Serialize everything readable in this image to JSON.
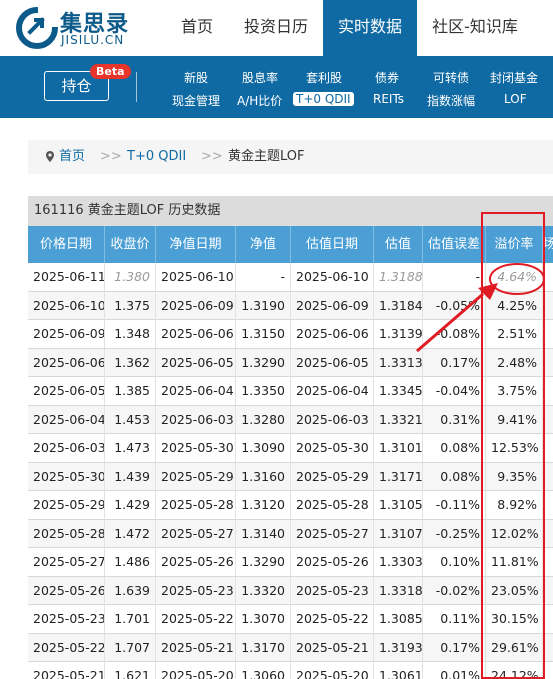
{
  "header": {
    "logo_cn": "集思录",
    "logo_en": "JISILU.CN",
    "nav": [
      {
        "label": "首页"
      },
      {
        "label": "投资日历"
      },
      {
        "label": "实时数据"
      },
      {
        "label": "社区-知识库"
      }
    ],
    "active_nav": "实时数据"
  },
  "subnav": {
    "hold_label": "持仓",
    "beta_label": "Beta",
    "row1": [
      "新股",
      "股息率",
      "套利股",
      "债券",
      "可转债",
      "封闭基金"
    ],
    "row2": [
      "现金管理",
      "A/H比价",
      "T+0 QDII",
      "REITs",
      "指数涨幅",
      "LOF"
    ],
    "active": "T+0 QDII"
  },
  "breadcrumb": {
    "home": "首页",
    "sep": ">>",
    "section": "T+0 QDII",
    "current": "黄金主题LOF"
  },
  "table": {
    "title": "161116 黄金主题LOF 历史数据",
    "columns": [
      "价格日期",
      "收盘价",
      "净值日期",
      "净值",
      "估值日期",
      "估值",
      "估值误差",
      "溢价率",
      "场"
    ],
    "rows": [
      [
        "2025-06-11",
        "1.380",
        "2025-06-10",
        "-",
        "2025-06-10",
        "1.3188",
        "-",
        "4.64%"
      ],
      [
        "2025-06-10",
        "1.375",
        "2025-06-09",
        "1.3190",
        "2025-06-09",
        "1.3184",
        "-0.05%",
        "4.25%"
      ],
      [
        "2025-06-09",
        "1.348",
        "2025-06-06",
        "1.3150",
        "2025-06-06",
        "1.3139",
        "-0.08%",
        "2.51%"
      ],
      [
        "2025-06-06",
        "1.362",
        "2025-06-05",
        "1.3290",
        "2025-06-05",
        "1.3313",
        "0.17%",
        "2.48%"
      ],
      [
        "2025-06-05",
        "1.385",
        "2025-06-04",
        "1.3350",
        "2025-06-04",
        "1.3345",
        "-0.04%",
        "3.75%"
      ],
      [
        "2025-06-04",
        "1.453",
        "2025-06-03",
        "1.3280",
        "2025-06-03",
        "1.3321",
        "0.31%",
        "9.41%"
      ],
      [
        "2025-06-03",
        "1.473",
        "2025-05-30",
        "1.3090",
        "2025-05-30",
        "1.3101",
        "0.08%",
        "12.53%"
      ],
      [
        "2025-05-30",
        "1.439",
        "2025-05-29",
        "1.3160",
        "2025-05-29",
        "1.3171",
        "0.08%",
        "9.35%"
      ],
      [
        "2025-05-29",
        "1.429",
        "2025-05-28",
        "1.3120",
        "2025-05-28",
        "1.3105",
        "-0.11%",
        "8.92%"
      ],
      [
        "2025-05-28",
        "1.472",
        "2025-05-27",
        "1.3140",
        "2025-05-27",
        "1.3107",
        "-0.25%",
        "12.02%"
      ],
      [
        "2025-05-27",
        "1.486",
        "2025-05-26",
        "1.3290",
        "2025-05-26",
        "1.3303",
        "0.10%",
        "11.81%"
      ],
      [
        "2025-05-26",
        "1.639",
        "2025-05-23",
        "1.3320",
        "2025-05-23",
        "1.3318",
        "-0.02%",
        "23.05%"
      ],
      [
        "2025-05-23",
        "1.701",
        "2025-05-22",
        "1.3070",
        "2025-05-22",
        "1.3085",
        "0.11%",
        "30.15%"
      ],
      [
        "2025-05-22",
        "1.707",
        "2025-05-21",
        "1.3170",
        "2025-05-21",
        "1.3193",
        "0.17%",
        "29.61%"
      ],
      [
        "2025-05-21",
        "1.621",
        "2025-05-20",
        "1.3060",
        "2025-05-20",
        "1.3061",
        "0.01%",
        "24.12%"
      ]
    ],
    "first_row_estimated": true
  },
  "colors": {
    "brand_blue": "#0f6aa3",
    "header_blue": "#4b9fd5",
    "annotation_red": "#e01b24",
    "beta_red": "#e7352b"
  },
  "icons": {
    "logo": "jisilu-logo-icon",
    "breadcrumb_pin": "location-pin-icon"
  }
}
